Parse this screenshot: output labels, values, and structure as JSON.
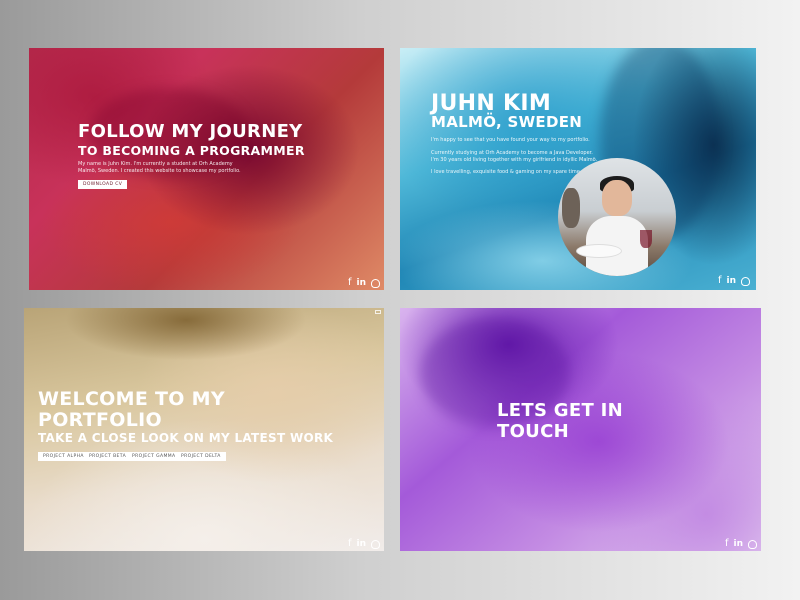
{
  "panels": {
    "journey": {
      "title_line1": "FOLLOW MY JOURNEY",
      "title_line2": "TO BECOMING A PROGRAMMER",
      "body_line1": "My name is Juhn Kim. I'm currently a student at Orh Academy",
      "body_line2": "Malmö, Sweden. I created this website to showcase my portfolio.",
      "button_label": "DOWNLOAD CV",
      "social_icons": [
        "facebook-icon",
        "linkedin-icon",
        "github-icon"
      ]
    },
    "about": {
      "name": "JUHN KIM",
      "location": "MALMÖ, SWEDEN",
      "line1": "I'm happy to see that you have found your way to my portfolio.",
      "line2": "Currently studying at Orh Academy to become a Java Developer.",
      "line3": "I'm 30 years old living together with my girlfriend in idyllic Malmö.",
      "line4": "I love travelling, exquisite food & gaming on my spare time.",
      "social_icons": [
        "facebook-icon",
        "linkedin-icon",
        "github-icon"
      ]
    },
    "portfolio": {
      "title_line1": "WELCOME TO MY",
      "title_line2": "PORTFOLIO",
      "subtitle": "TAKE A CLOSE LOOK ON MY LATEST WORK",
      "projects": [
        "PROJECT ALPHA",
        "PROJECT BETA",
        "PROJECT GAMMA",
        "PROJECT DELTA"
      ],
      "social_icons": [
        "facebook-icon",
        "linkedin-icon",
        "github-icon"
      ]
    },
    "contact": {
      "title_line1": "LETS GET IN",
      "title_line2": "TOUCH",
      "social_icons": [
        "facebook-icon",
        "linkedin-icon",
        "github-icon"
      ]
    }
  },
  "social_glyphs": {
    "facebook": "f",
    "linkedin": "in"
  }
}
